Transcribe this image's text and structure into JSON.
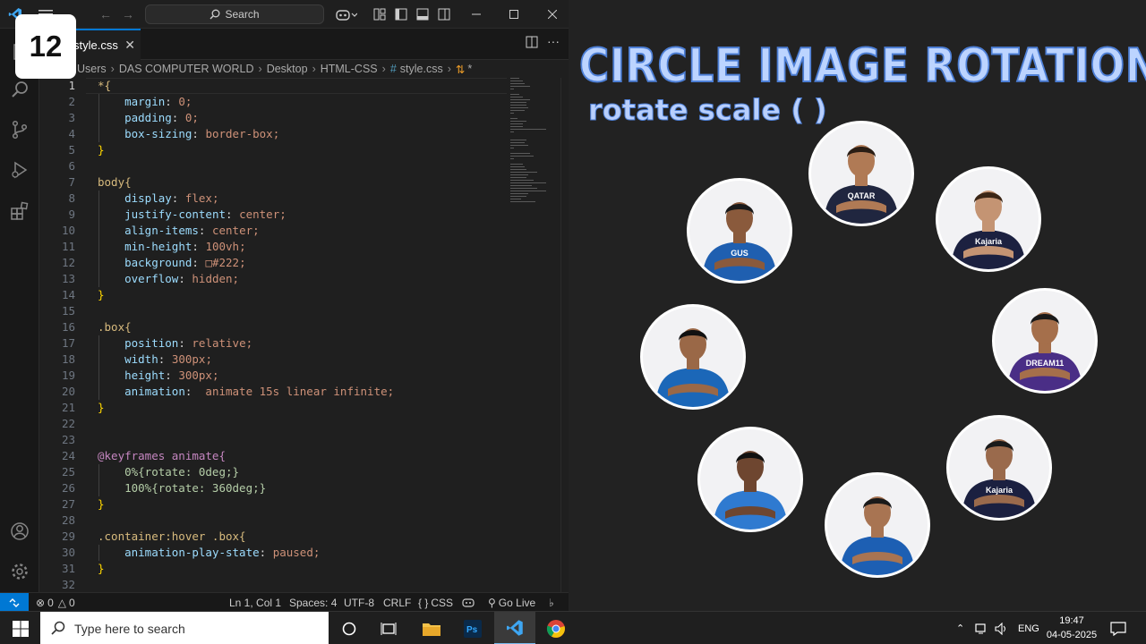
{
  "video_badge": "12",
  "vscode": {
    "search_label": "Search",
    "tab": {
      "filename": "style.css",
      "close_icon": "close-icon"
    },
    "breadcrumb": [
      "Users",
      "DAS COMPUTER WORLD",
      "Desktop",
      "HTML-CSS",
      "style.css",
      "*"
    ],
    "code_lines": [
      {
        "n": "1",
        "text": "*{"
      },
      {
        "n": "2",
        "text": "    margin: 0;"
      },
      {
        "n": "3",
        "text": "    padding: 0;"
      },
      {
        "n": "4",
        "text": "    box-sizing: border-box;"
      },
      {
        "n": "5",
        "text": "}"
      },
      {
        "n": "6",
        "text": ""
      },
      {
        "n": "7",
        "text": "body{"
      },
      {
        "n": "8",
        "text": "    display: flex;"
      },
      {
        "n": "9",
        "text": "    justify-content: center;"
      },
      {
        "n": "10",
        "text": "    align-items: center;"
      },
      {
        "n": "11",
        "text": "    min-height: 100vh;"
      },
      {
        "n": "12",
        "text": "    background: □#222;"
      },
      {
        "n": "13",
        "text": "    overflow: hidden;"
      },
      {
        "n": "14",
        "text": "}"
      },
      {
        "n": "15",
        "text": ""
      },
      {
        "n": "16",
        "text": ".box{"
      },
      {
        "n": "17",
        "text": "    position: relative;"
      },
      {
        "n": "18",
        "text": "    width: 300px;"
      },
      {
        "n": "19",
        "text": "    height: 300px;"
      },
      {
        "n": "20",
        "text": "    animation:  animate 15s linear infinite;"
      },
      {
        "n": "21",
        "text": "}"
      },
      {
        "n": "22",
        "text": ""
      },
      {
        "n": "23",
        "text": ""
      },
      {
        "n": "24",
        "text": "@keyframes animate{"
      },
      {
        "n": "25",
        "text": "    0%{rotate: 0deg;}"
      },
      {
        "n": "26",
        "text": "    100%{rotate: 360deg;}"
      },
      {
        "n": "27",
        "text": "}"
      },
      {
        "n": "28",
        "text": ""
      },
      {
        "n": "29",
        "text": ".container:hover .box{"
      },
      {
        "n": "30",
        "text": "    animation-play-state: paused;"
      },
      {
        "n": "31",
        "text": "}"
      },
      {
        "n": "32",
        "text": ""
      }
    ],
    "status": {
      "errors": "0",
      "warnings": "0",
      "position": "Ln 1, Col 1",
      "spaces": "Spaces: 4",
      "encoding": "UTF-8",
      "eol": "CRLF",
      "language": "CSS",
      "golive": "Go Live"
    }
  },
  "preview": {
    "title": "CIRCLE IMAGE ROTATION",
    "subtitle": "rotate scale ( )",
    "avatars": [
      {
        "jersey": "#1f5fb0",
        "skin": "#8a5a3c",
        "hair": "#1a1a1a",
        "text": "GUS"
      },
      {
        "jersey": "#20263f",
        "skin": "#b07a55",
        "hair": "#2a1d14",
        "text": "QATAR"
      },
      {
        "jersey": "#1c2140",
        "skin": "#c49473",
        "hair": "#3b2616",
        "text": "Kajaria"
      },
      {
        "jersey": "#1b67b8",
        "skin": "#9a6847",
        "hair": "#111111",
        "text": ""
      },
      {
        "jersey": "#4a2e86",
        "skin": "#a56f4b",
        "hair": "#1a1a1a",
        "text": "DREAM11"
      },
      {
        "jersey": "#2f7ad0",
        "skin": "#6e4630",
        "hair": "#111111",
        "text": ""
      },
      {
        "jersey": "#1d5fb3",
        "skin": "#a87452",
        "hair": "#1a1a1a",
        "text": ""
      },
      {
        "jersey": "#1b2040",
        "skin": "#9a6a4c",
        "hair": "#1a1a1a",
        "text": "Kajaria"
      }
    ]
  },
  "taskbar": {
    "search_placeholder": "Type here to search",
    "lang": "ENG",
    "time": "19:47",
    "date": "04-05-2025"
  }
}
